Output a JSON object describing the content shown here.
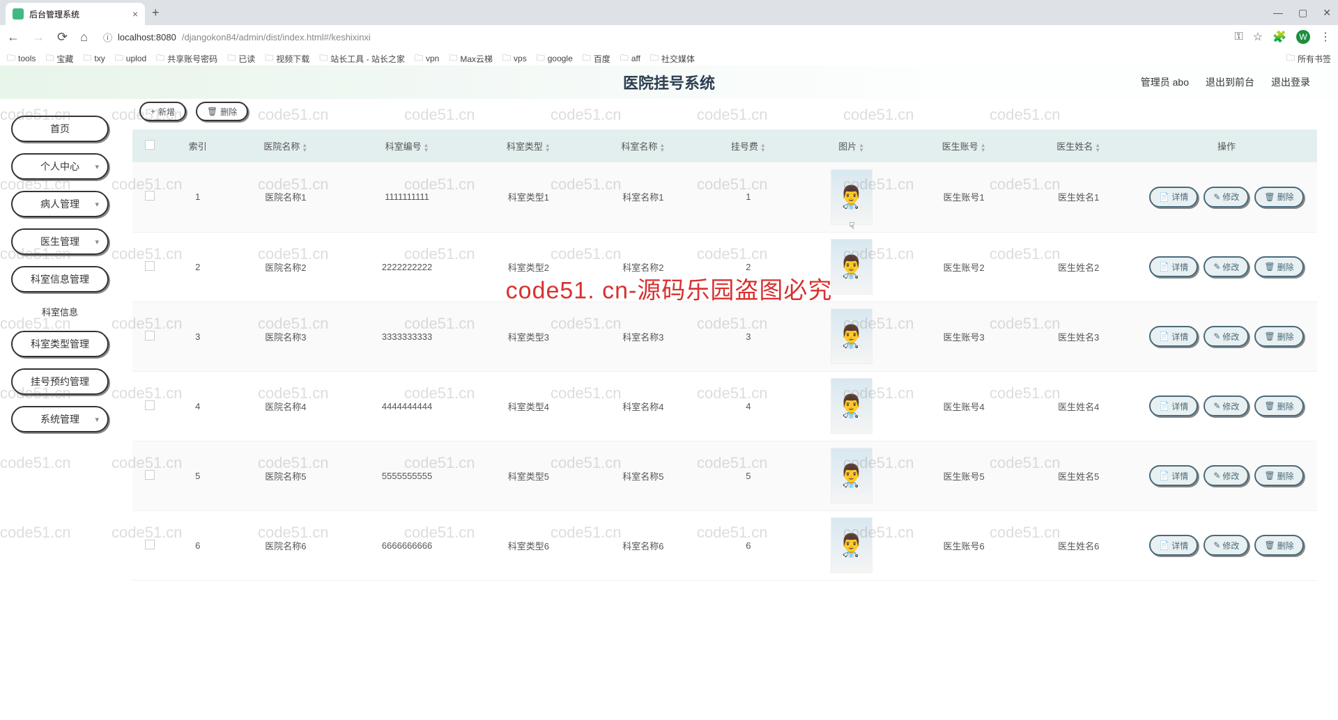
{
  "browser": {
    "tab_title": "后台管理系统",
    "url_host": "localhost:8080",
    "url_path": "/djangokon84/admin/dist/index.html#/keshixinxi",
    "bookmarks": [
      "tools",
      "宝藏",
      "txy",
      "uplod",
      "共享账号密码",
      "已读",
      "视频下载",
      "站长工具 - 站长之家",
      "vpn",
      "Max云梯",
      "vps",
      "google",
      "百度",
      "aff",
      "社交媒体"
    ],
    "all_bookmarks": "所有书签",
    "profile_letter": "W"
  },
  "header": {
    "title": "医院挂号系统",
    "admin": "管理员 abo",
    "exit_front": "退出到前台",
    "logout": "退出登录"
  },
  "sidebar": {
    "items": [
      {
        "label": "首页",
        "has_chev": false
      },
      {
        "label": "个人中心",
        "has_chev": true
      },
      {
        "label": "病人管理",
        "has_chev": true
      },
      {
        "label": "医生管理",
        "has_chev": true
      },
      {
        "label": "科室信息管理",
        "has_chev": false
      },
      {
        "label": "科室类型管理",
        "has_chev": false
      },
      {
        "label": "挂号预约管理",
        "has_chev": false
      },
      {
        "label": "系统管理",
        "has_chev": true
      }
    ],
    "sub_item": "科室信息"
  },
  "toolbar": {
    "add": "新增",
    "delete": "删除"
  },
  "table": {
    "headers": [
      "",
      "索引",
      "医院名称",
      "科室编号",
      "科室类型",
      "科室名称",
      "挂号费",
      "图片",
      "医生账号",
      "医生姓名",
      "操作"
    ],
    "rows": [
      {
        "idx": "1",
        "hosp": "医院名称1",
        "deptno": "1111111111",
        "dtype": "科室类型1",
        "dname": "科室名称1",
        "fee": "1",
        "dacc": "医生账号1",
        "docname": "医生姓名1"
      },
      {
        "idx": "2",
        "hosp": "医院名称2",
        "deptno": "2222222222",
        "dtype": "科室类型2",
        "dname": "科室名称2",
        "fee": "2",
        "dacc": "医生账号2",
        "docname": "医生姓名2"
      },
      {
        "idx": "3",
        "hosp": "医院名称3",
        "deptno": "3333333333",
        "dtype": "科室类型3",
        "dname": "科室名称3",
        "fee": "3",
        "dacc": "医生账号3",
        "docname": "医生姓名3"
      },
      {
        "idx": "4",
        "hosp": "医院名称4",
        "deptno": "4444444444",
        "dtype": "科室类型4",
        "dname": "科室名称4",
        "fee": "4",
        "dacc": "医生账号4",
        "docname": "医生姓名4"
      },
      {
        "idx": "5",
        "hosp": "医院名称5",
        "deptno": "5555555555",
        "dtype": "科室类型5",
        "dname": "科室名称5",
        "fee": "5",
        "dacc": "医生账号5",
        "docname": "医生姓名5"
      },
      {
        "idx": "6",
        "hosp": "医院名称6",
        "deptno": "6666666666",
        "dtype": "科室类型6",
        "dname": "科室名称6",
        "fee": "6",
        "dacc": "医生账号6",
        "docname": "医生姓名6"
      }
    ],
    "actions": {
      "detail": "详情",
      "edit": "修改",
      "delete": "删除"
    }
  },
  "watermark": "code51.cn",
  "center_watermark": "code51. cn-源码乐园盗图必究"
}
